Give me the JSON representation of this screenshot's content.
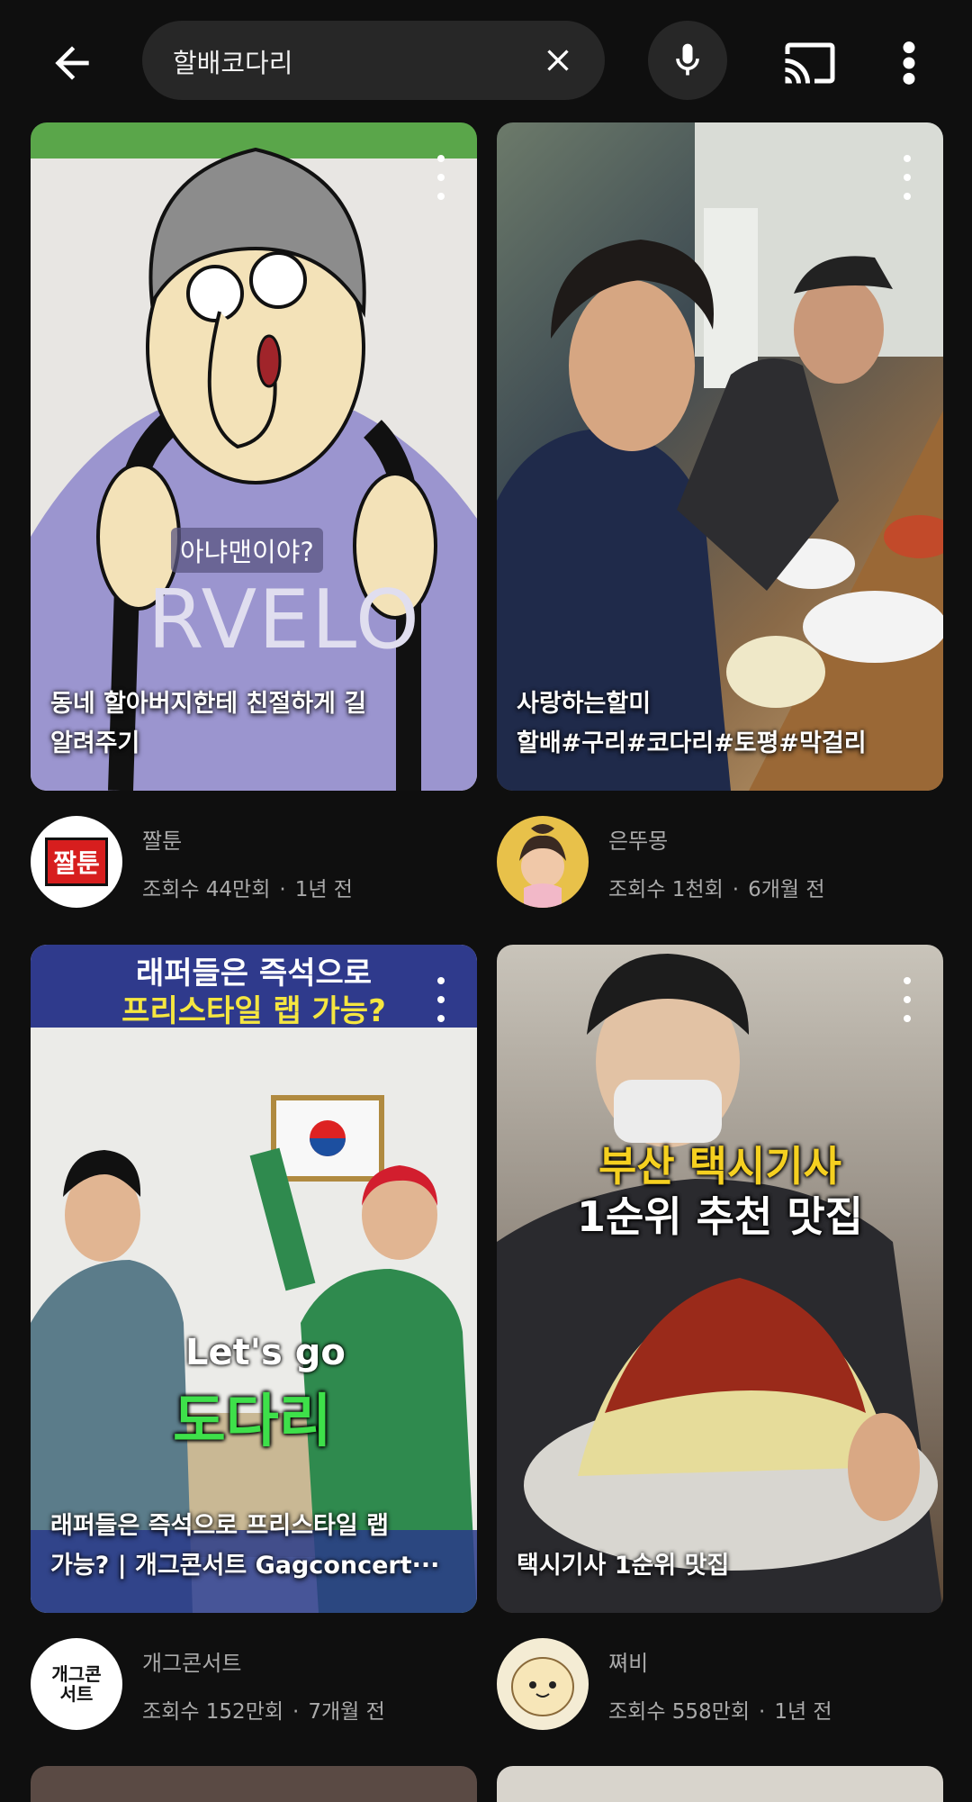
{
  "search": {
    "query": "할배코다리"
  },
  "colors": {
    "background": "#0f0f0f",
    "search_bg": "#272727",
    "text_secondary": "#aaaaaa"
  },
  "icons": [
    "back-arrow-icon",
    "close-icon",
    "microphone-icon",
    "cast-icon",
    "more-vert-icon"
  ],
  "videos": [
    {
      "title_line1": "동네 할아버지한테 친절하게 길",
      "title_line2": "알려주기",
      "overlay_caption": "아냐맨이야?",
      "overlay_shirt": "RVELO",
      "channel": "짤툰",
      "avatar_text": "짤툰",
      "views": "조회수 44만회",
      "age": "1년 전"
    },
    {
      "title_line1": "사랑하는할미",
      "title_line2": "할배#구리#코다리#토평#막걸리",
      "channel": "은뚜몽",
      "views": "조회수 1천회",
      "age": "6개월 전"
    },
    {
      "title_line1": "래퍼들은 즉석으로 프리스타일 랩",
      "title_line2": "가능? | 개그콘서트 Gagconcert···",
      "banner_line1": "래퍼들은 즉석으로",
      "banner_line2": "프리스타일 랩 가능?",
      "overlay_en": "Let's go",
      "overlay_ko": "도다리",
      "channel": "개그콘서트",
      "avatar_text": "개그콘서트",
      "views": "조회수 152만회",
      "age": "7개월 전"
    },
    {
      "title_line1": "택시기사 1순위 맛집",
      "title_line2": "",
      "overlay_line1": "부산 택시기사",
      "overlay_line2": "1순위 추천 맛집",
      "channel": "쪄비",
      "views": "조회수 558만회",
      "age": "1년 전"
    }
  ]
}
